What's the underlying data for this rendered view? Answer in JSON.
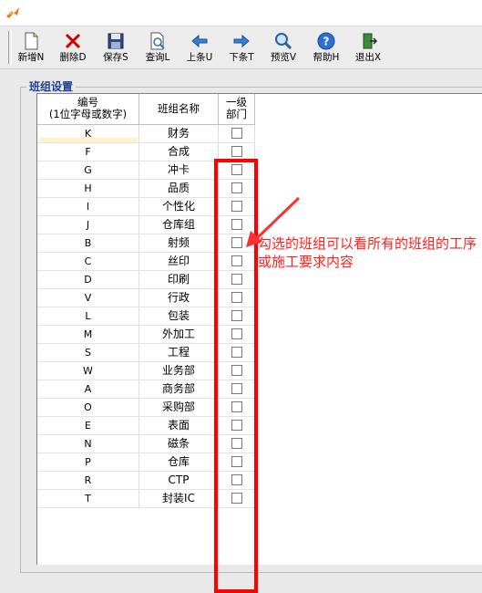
{
  "toolbar": {
    "new": "新增N",
    "delete": "删除D",
    "save": "保存S",
    "query": "查询L",
    "prev": "上条U",
    "next": "下条T",
    "preview": "预览V",
    "help": "帮助H",
    "exit": "退出X"
  },
  "group_title": "班组设置",
  "table": {
    "headers": {
      "code_line1": "编号",
      "code_line2": "(1位字母或数字)",
      "name": "班组名称",
      "level_line1": "一级",
      "level_line2": "部门"
    },
    "rows": [
      {
        "code": "K",
        "name": "财务",
        "checked": false
      },
      {
        "code": "F",
        "name": "合成",
        "checked": false
      },
      {
        "code": "G",
        "name": "冲卡",
        "checked": false
      },
      {
        "code": "H",
        "name": "品质",
        "checked": false
      },
      {
        "code": "I",
        "name": "个性化",
        "checked": false
      },
      {
        "code": "J",
        "name": "仓库组",
        "checked": false
      },
      {
        "code": "B",
        "name": "射频",
        "checked": false
      },
      {
        "code": "C",
        "name": "丝印",
        "checked": false
      },
      {
        "code": "D",
        "name": "印刷",
        "checked": false
      },
      {
        "code": "V",
        "name": "行政",
        "checked": false
      },
      {
        "code": "L",
        "name": "包装",
        "checked": false
      },
      {
        "code": "M",
        "name": "外加工",
        "checked": false
      },
      {
        "code": "S",
        "name": "工程",
        "checked": false
      },
      {
        "code": "W",
        "name": "业务部",
        "checked": false
      },
      {
        "code": "A",
        "name": "商务部",
        "checked": false
      },
      {
        "code": "O",
        "name": "采购部",
        "checked": false
      },
      {
        "code": "E",
        "name": "表面",
        "checked": false
      },
      {
        "code": "N",
        "name": "磁条",
        "checked": false
      },
      {
        "code": "P",
        "name": "仓库",
        "checked": false
      },
      {
        "code": "R",
        "name": "CTP",
        "checked": false
      },
      {
        "code": "T",
        "name": "封装IC",
        "checked": false
      }
    ]
  },
  "annotation": {
    "text": "勾选的班组可以看所有的班组的工序或施工要求内容",
    "color": "#ff2020"
  },
  "colors": {
    "highlight_border": "#ff0000",
    "group_title": "#1d3f8e"
  }
}
